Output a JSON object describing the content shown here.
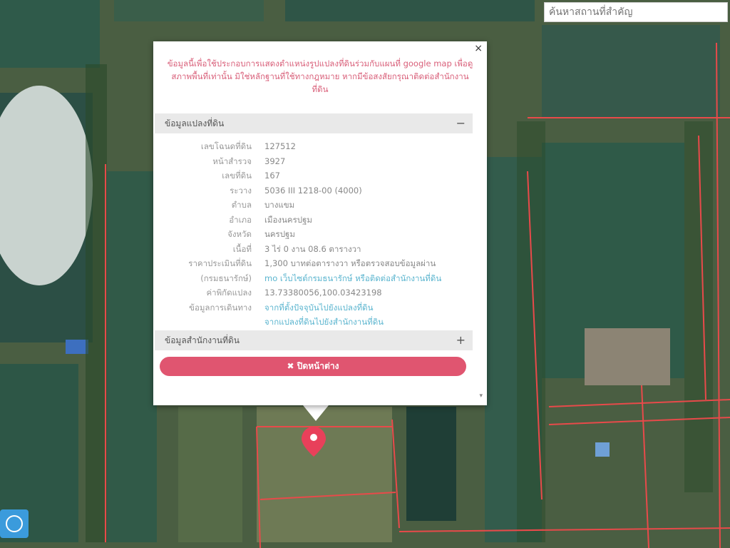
{
  "search": {
    "placeholder": "ค้นหาสถานที่สำคัญ"
  },
  "popup": {
    "notice": "ข้อมูลนี้เพื่อใช้ประกอบการแสดงตำแหน่งรูปแปลงที่ดินร่วมกับแผนที่ google map เพื่อดูสภาพพื้นที่เท่านั้น มิใช่หลักฐานที่ใช้ทางกฎหมาย หากมีข้อสงสัยกรุณาติดต่อสำนักงานที่ดิน",
    "close_x": "×",
    "section1": {
      "title": "ข้อมูลแปลงที่ดิน",
      "sign": "−"
    },
    "section2": {
      "title": "ข้อมูลสำนักงานที่ดิน",
      "sign": "+"
    },
    "rows": [
      {
        "k": "เลขโฉนดที่ดิน",
        "v": "127512"
      },
      {
        "k": "หน้าสำรวจ",
        "v": "3927"
      },
      {
        "k": "เลขที่ดิน",
        "v": "167"
      },
      {
        "k": "ระวาง",
        "v": "5036 III 1218-00 (4000)"
      },
      {
        "k": "ตำบล",
        "v": "บางแขม"
      },
      {
        "k": "อำเภอ",
        "v": "เมืองนครปฐม"
      },
      {
        "k": "จังหวัด",
        "v": "นครปฐม"
      },
      {
        "k": "เนื้อที่",
        "v": "3 ไร่ 0 งาน 08.6 ตารางวา"
      },
      {
        "k": "ราคาประเมินที่ดิน",
        "v": "1,300 บาทต่อตารางวา หรือตรวจสอบข้อมูลผ่าน"
      },
      {
        "k": "(กรมธนารักษ์)",
        "v": "mo เว็บไซต์กรมธนารักษ์ หรือติดต่อสำนักงานที่ดิน",
        "link": true
      },
      {
        "k": "ค่าพิกัดแปลง",
        "v": "13.73380056,100.03423198"
      },
      {
        "k": "ข้อมูลการเดินทาง",
        "v": "จากที่ตั้งปัจจุบันไปยังแปลงที่ดิน",
        "link": true
      },
      {
        "k": "",
        "v": "จากแปลงที่ดินไปยังสำนักงานที่ดิน",
        "link": true
      }
    ],
    "close_button": "✖ ปิดหน้าต่าง",
    "scroll_indicator": "▾"
  },
  "colors": {
    "accent": "#e05570",
    "notice": "#d9607a",
    "link": "#5bb5cf",
    "boundary": "#e84a4a"
  }
}
